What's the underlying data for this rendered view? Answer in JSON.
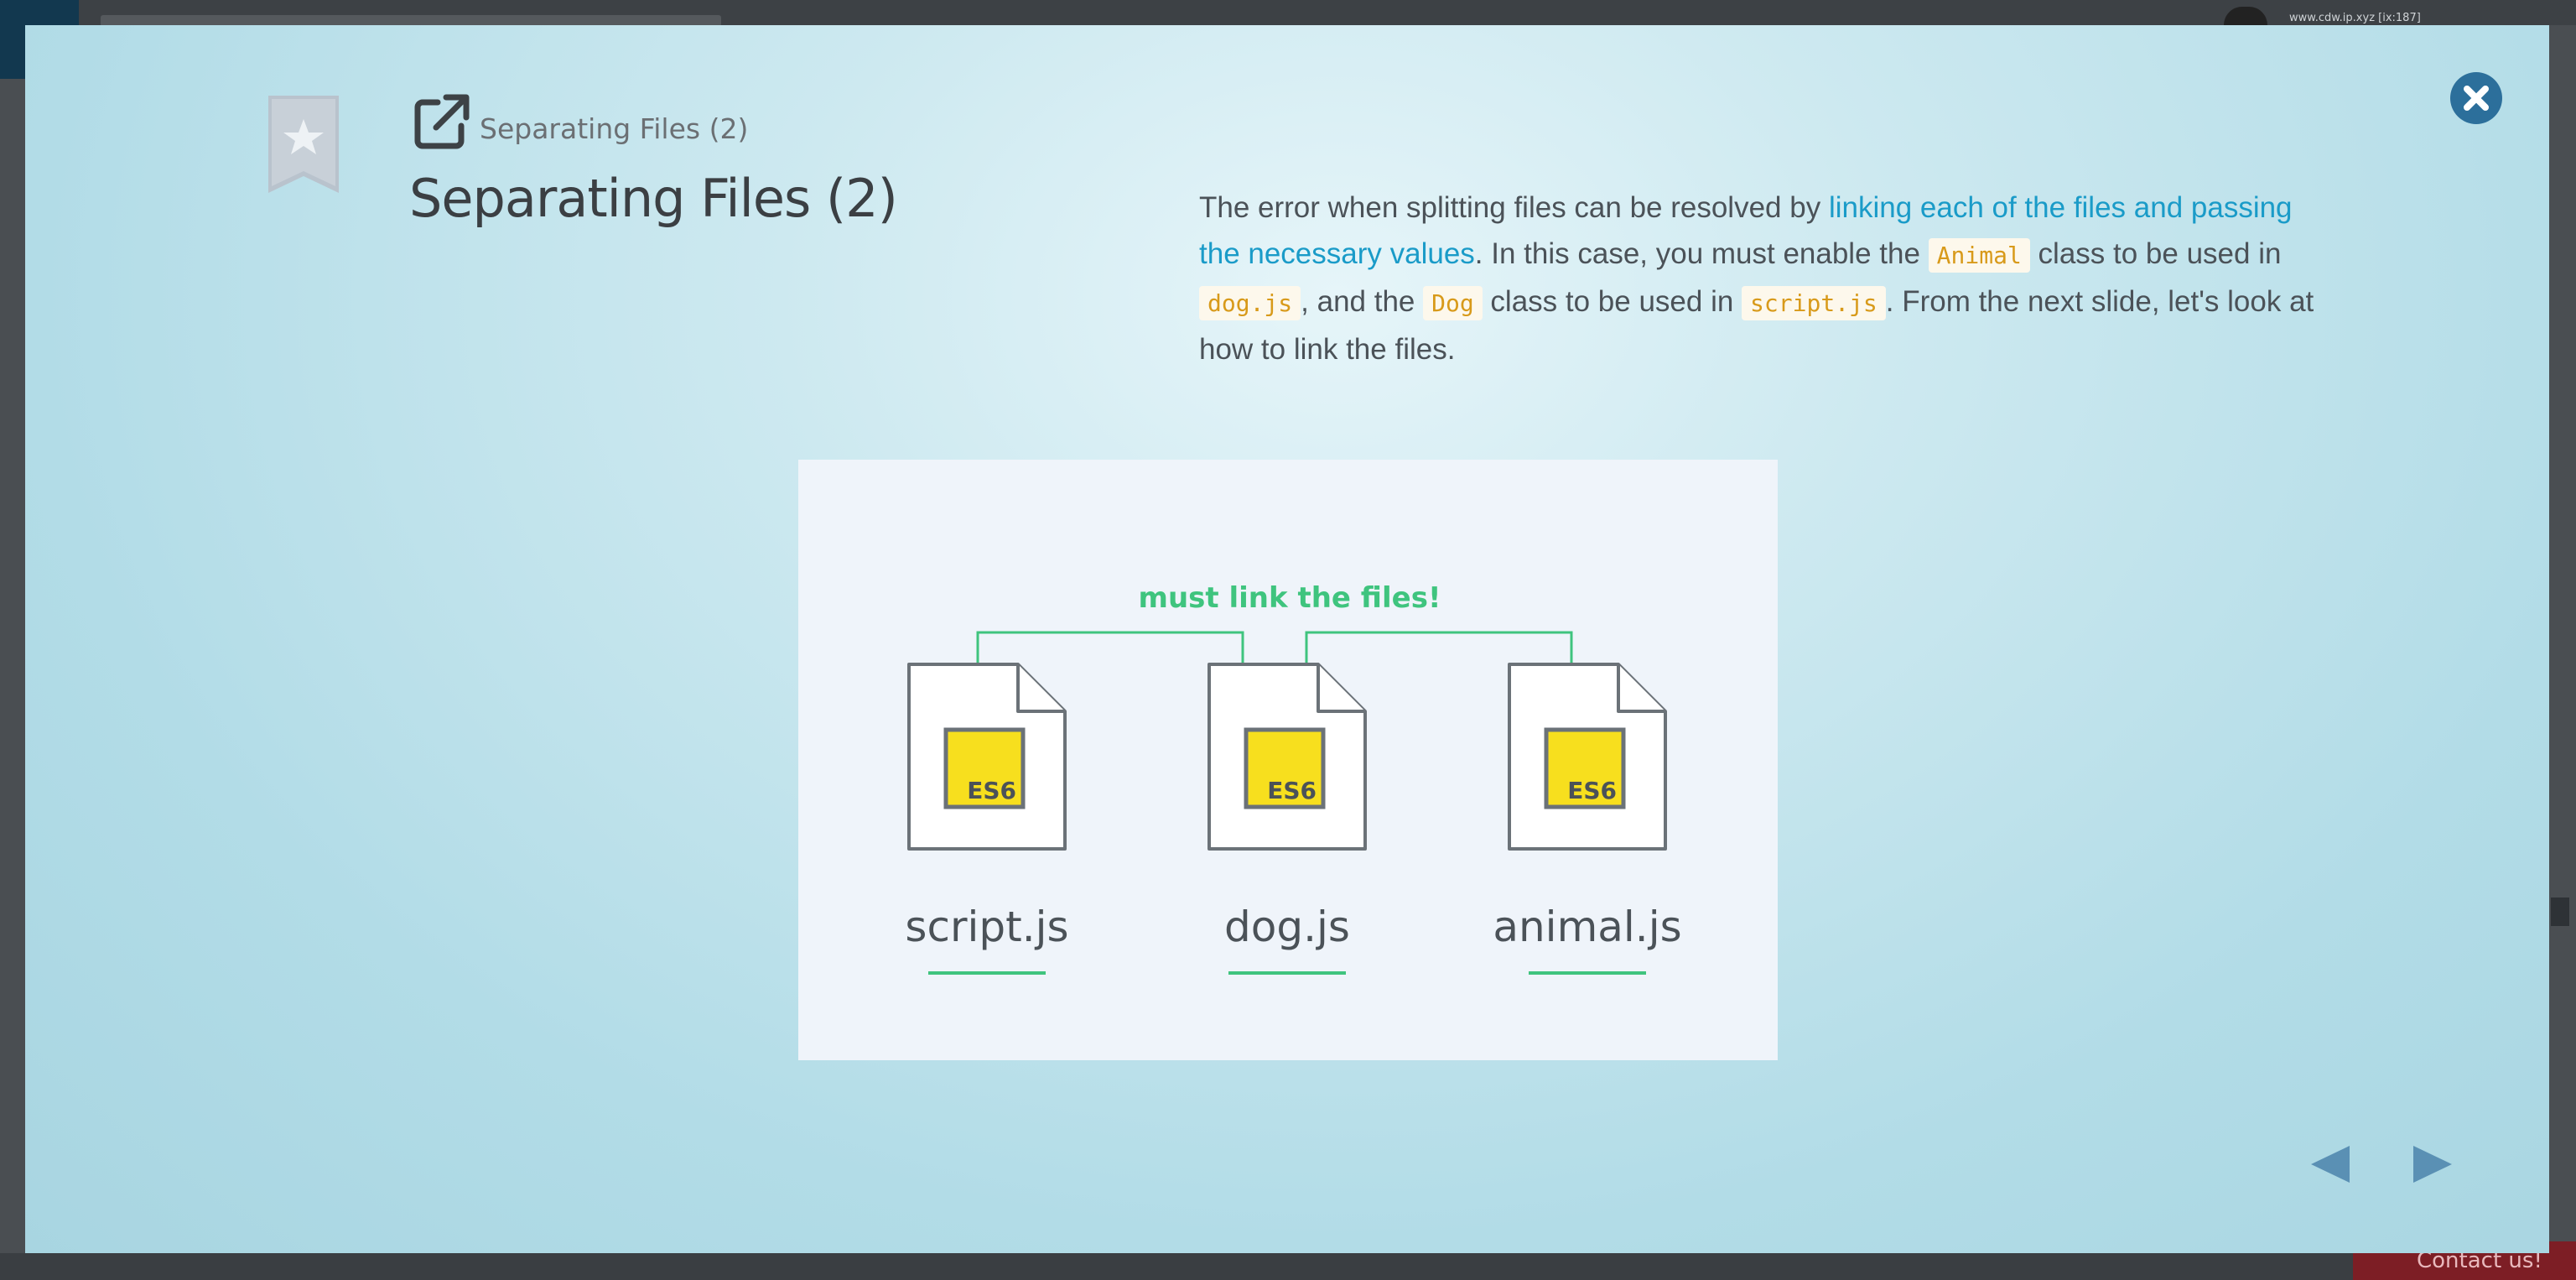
{
  "background": {
    "url_text": "www.cdw.ip.xyz [ix:187]",
    "contact_label": "Contact us!"
  },
  "modal": {
    "breadcrumb": "Separating Files (2)",
    "title": "Separating Files (2)",
    "description": {
      "part1": "The error when splitting files can be resolved by ",
      "link": "linking each of the files and passing the necessary values",
      "part2": ". In this case, you must enable the ",
      "code1": "Animal",
      "part3": " class to be used in ",
      "code2": "dog.js",
      "part4": ", and the ",
      "code3": "Dog",
      "part5": " class to be used in ",
      "code4": "script.js",
      "part6": ". From the next slide, let's look at how to link the files."
    },
    "figure": {
      "caption": "must link the files!",
      "badge": "ES6",
      "files": [
        "script.js",
        "dog.js",
        "animal.js"
      ]
    }
  },
  "colors": {
    "accent": "#1a9bc8",
    "close_button": "#2c6f9b",
    "code_text": "#d89a1a",
    "figure_line": "#3fc47e",
    "es6_yellow": "#f7df1e",
    "nav_arrow": "#5a90b4"
  },
  "icons": {
    "bookmark": "bookmark-star-icon",
    "external": "external-link-icon",
    "close": "close-icon",
    "prev": "triangle-left-icon",
    "next": "triangle-right-icon"
  }
}
